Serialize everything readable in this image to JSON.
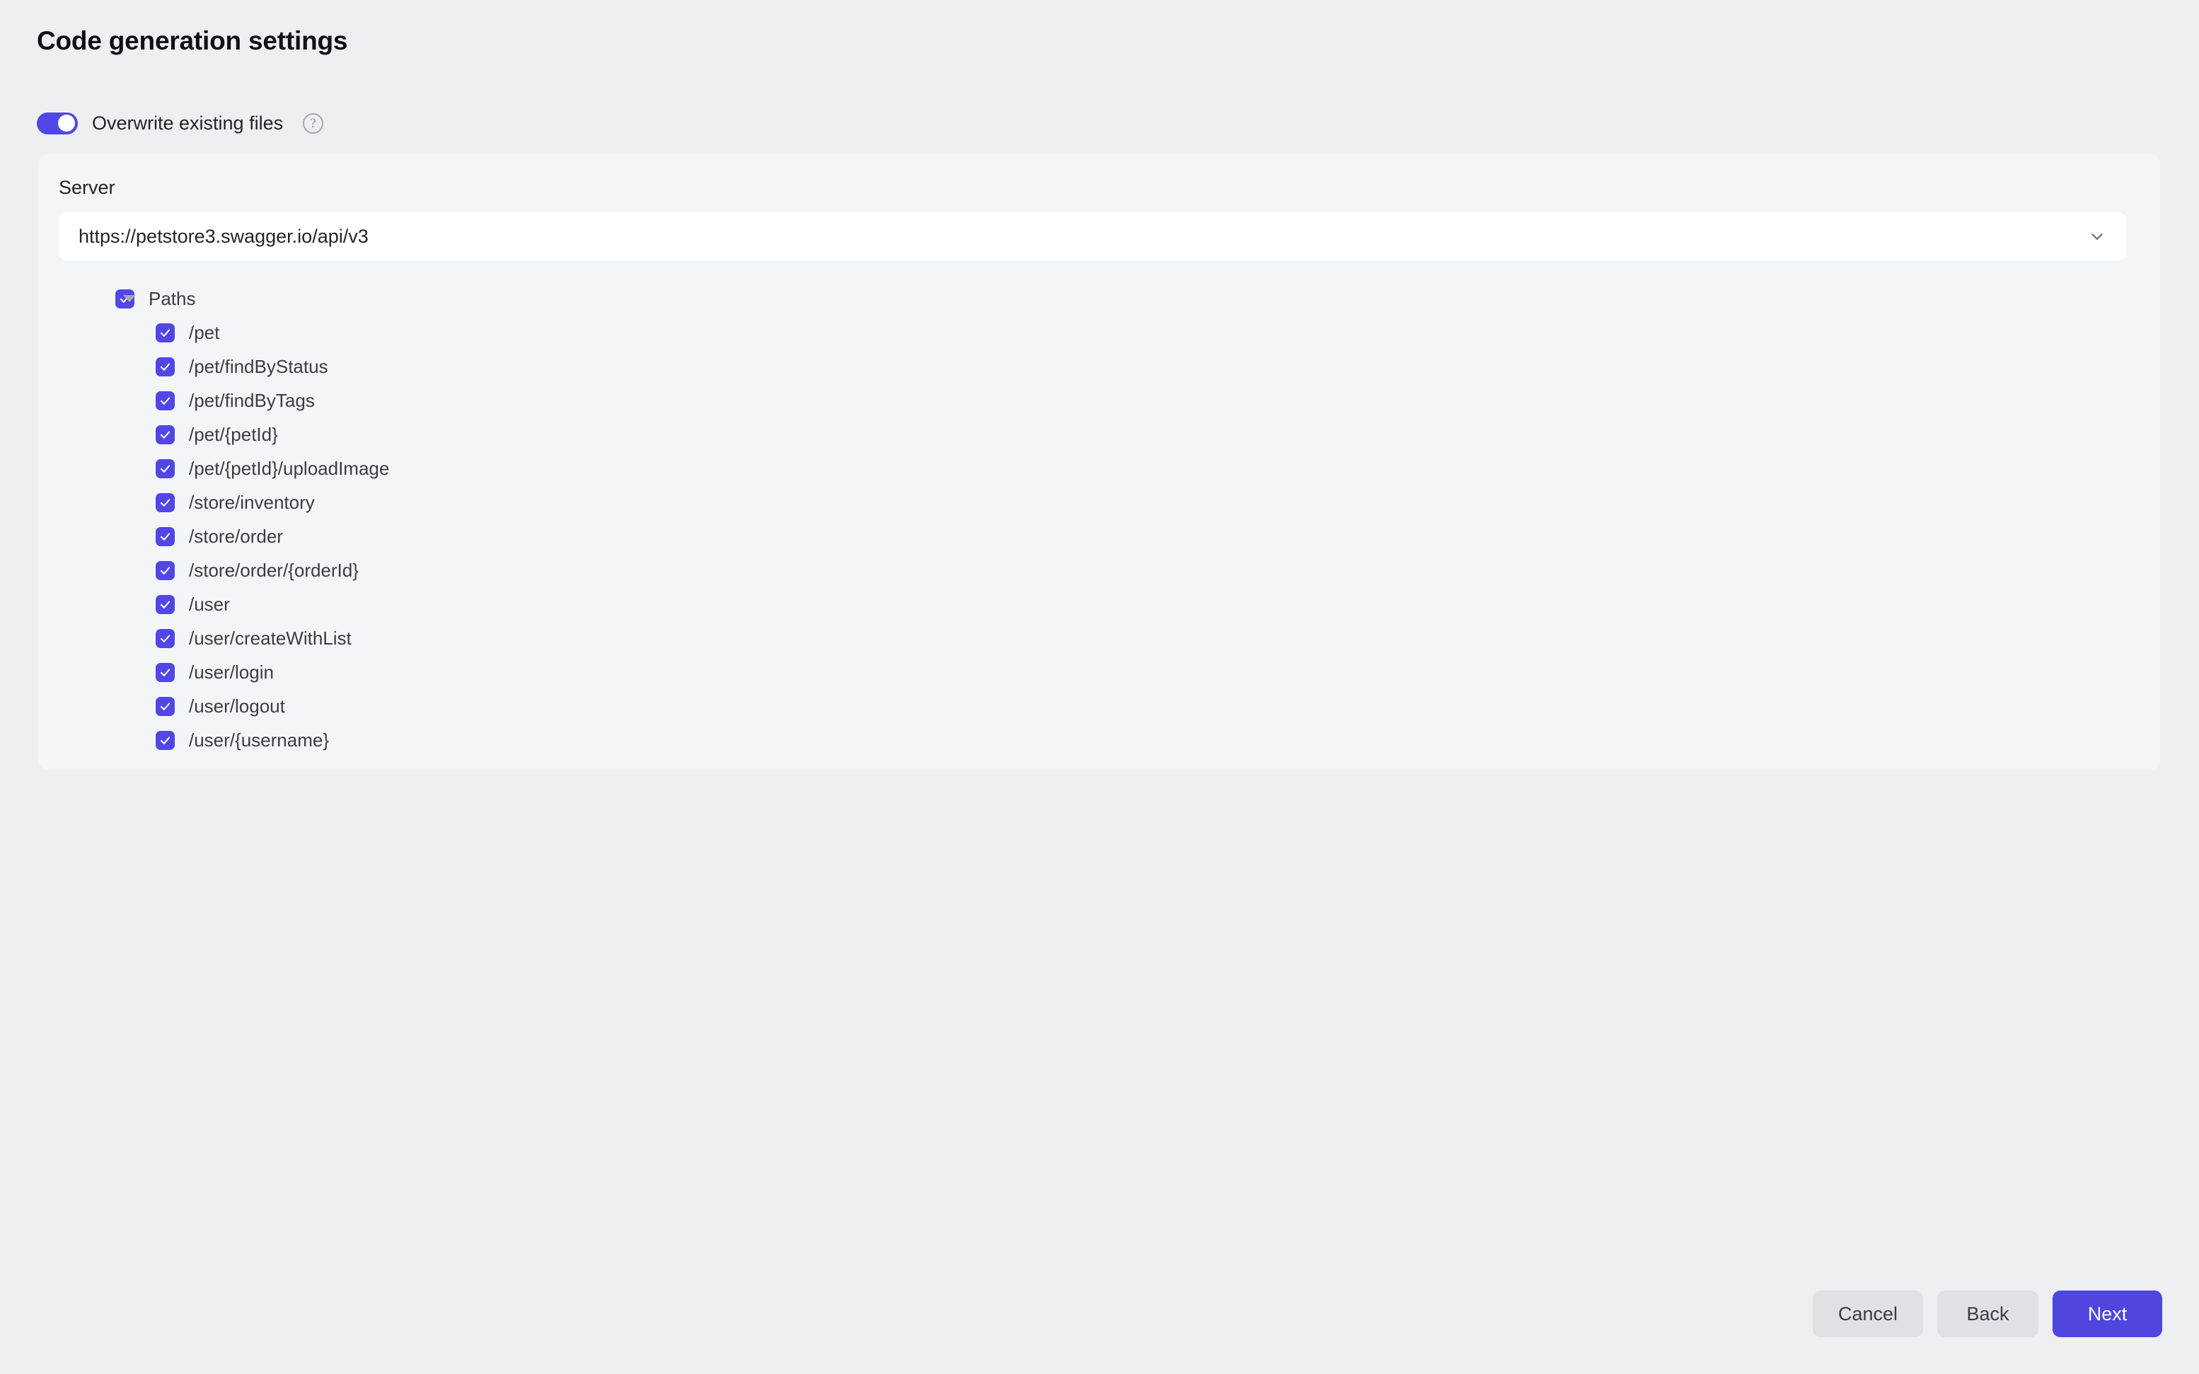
{
  "page": {
    "title": "Code generation settings"
  },
  "overwrite": {
    "label": "Overwrite existing files",
    "toggle_on": true,
    "help_icon": "question-mark-circle-icon",
    "help_glyph": "?"
  },
  "server": {
    "label": "Server",
    "value": "https://petstore3.swagger.io/api/v3",
    "chevron_icon": "chevron-down-icon"
  },
  "tree": {
    "root": {
      "label": "Paths",
      "checked": true,
      "expanded": true,
      "expander_icon": "caret-down-icon"
    },
    "items": [
      {
        "label": "/pet",
        "checked": true
      },
      {
        "label": "/pet/findByStatus",
        "checked": true
      },
      {
        "label": "/pet/findByTags",
        "checked": true
      },
      {
        "label": "/pet/{petId}",
        "checked": true
      },
      {
        "label": "/pet/{petId}/uploadImage",
        "checked": true
      },
      {
        "label": "/store/inventory",
        "checked": true
      },
      {
        "label": "/store/order",
        "checked": true
      },
      {
        "label": "/store/order/{orderId}",
        "checked": true
      },
      {
        "label": "/user",
        "checked": true
      },
      {
        "label": "/user/createWithList",
        "checked": true
      },
      {
        "label": "/user/login",
        "checked": true
      },
      {
        "label": "/user/logout",
        "checked": true
      },
      {
        "label": "/user/{username}",
        "checked": true
      }
    ]
  },
  "footer": {
    "cancel_label": "Cancel",
    "back_label": "Back",
    "next_label": "Next"
  },
  "colors": {
    "accent": "#5146e6",
    "primary_button": "#4f46e0",
    "page_background": "#eeeff1",
    "panel_background": "#f4f5f7",
    "input_background": "#ffffff",
    "secondary_button": "#dfe1e5",
    "text": "#22242a",
    "muted_text": "#3a3d45"
  }
}
